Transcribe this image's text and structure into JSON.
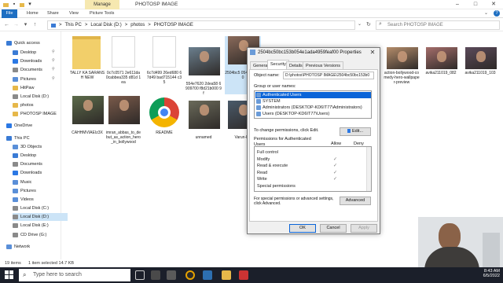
{
  "window": {
    "title": "PHOTOSP IMAGE",
    "manage_tab": "Manage",
    "minimize": "–",
    "maximize": "□",
    "close": "✕"
  },
  "ribbon": {
    "tabs": [
      "File",
      "Home",
      "Share",
      "View",
      "Picture Tools"
    ]
  },
  "address": {
    "crumbs": [
      "This PC",
      "Local Disk (D:)",
      "photos",
      "PHOTOSP IMAGE"
    ],
    "sep": ">",
    "search_placeholder": "Search PHOTOSP IMAGE"
  },
  "nav": {
    "items": [
      {
        "label": "Quick access",
        "color": "#3a7bd5"
      },
      {
        "label": "Desktop",
        "color": "#3a7bd5"
      },
      {
        "label": "Downloads",
        "color": "#2b78e4"
      },
      {
        "label": "Documents",
        "color": "#8a8a8a"
      },
      {
        "label": "Pictures",
        "color": "#5a8fd8"
      },
      {
        "label": "HitPaw",
        "color": "#e6b84a"
      },
      {
        "label": "Local Disk (D:)",
        "color": "#8a8a8a"
      },
      {
        "label": "photos",
        "color": "#e6b84a"
      },
      {
        "label": "PHOTOSP IMAGE",
        "color": "#e6b84a"
      },
      {
        "label": "OneDrive",
        "color": "#2b78e4"
      },
      {
        "label": "This PC",
        "color": "#3a7bd5"
      },
      {
        "label": "3D Objects",
        "color": "#5a8fd8"
      },
      {
        "label": "Desktop",
        "color": "#3a7bd5"
      },
      {
        "label": "Documents",
        "color": "#8a8a8a"
      },
      {
        "label": "Downloads",
        "color": "#2b78e4"
      },
      {
        "label": "Music",
        "color": "#5a8fd8"
      },
      {
        "label": "Pictures",
        "color": "#5a8fd8"
      },
      {
        "label": "Videos",
        "color": "#5a8fd8"
      },
      {
        "label": "Local Disk (C:)",
        "color": "#8a8a8a"
      },
      {
        "label": "Local Disk (D:)",
        "color": "#8a8a8a"
      },
      {
        "label": "Local Disk (E:)",
        "color": "#8a8a8a"
      },
      {
        "label": "CD Drive (G:)",
        "color": "#8a8a8a"
      },
      {
        "label": "Network",
        "color": "#5a8fd8"
      }
    ]
  },
  "files": [
    {
      "name": "TALLY KA SARANSH NEW",
      "kind": "folder"
    },
    {
      "name": "0c7c0571 2e611da 0cabbea335 d81d 1ea",
      "kind": "blank"
    },
    {
      "name": "6c7d499 26ed680 67d49 bad715144 c35",
      "kind": "blank"
    },
    {
      "name": "554e7620 2dea58 6909700 f8d21b000 9f",
      "kind": "photo",
      "color": "#6b7f8e"
    },
    {
      "name": "2504bc5 054e1ad f00",
      "kind": "photo",
      "color": "#8a6a5a"
    },
    {
      "name": "action-bollywood-comedy-hero-wallpaper-preview",
      "kind": "photo",
      "color": "#b48c6a"
    },
    {
      "name": "avika211019_082",
      "kind": "photo",
      "color": "#a46d6a"
    },
    {
      "name": "avika211019_103",
      "kind": "photo",
      "color": "#5b4a5a"
    },
    {
      "name": "CAHHMVIAEIz3X",
      "kind": "photo",
      "color": "#5c6b4a"
    },
    {
      "name": "imran_abbas_to_debut_as_action_hero_in_bollywood",
      "kind": "photo",
      "color": "#7a5a4a"
    },
    {
      "name": "README",
      "kind": "chrome"
    },
    {
      "name": "unnamed",
      "kind": "photo",
      "color": "#6a6a5a"
    },
    {
      "name": "Varun-Dh",
      "kind": "photo",
      "color": "#4a5a6a"
    }
  ],
  "status": {
    "count": "19 items",
    "selection": "1 item selected 14.7 KB"
  },
  "taskbar": {
    "search": "Type here to search",
    "time": "8:43 AM",
    "date": "6/5/2022"
  },
  "dialog": {
    "title": "2504bc50bc153b054e1ada4959feaf00 Properties",
    "close": "✕",
    "tabs": [
      "General",
      "Security",
      "Details",
      "Previous Versions"
    ],
    "object_name_label": "Object name:",
    "object_name_value": "D:\\photos\\PHOTOSP IMAGE\\2504bc50bc153b0",
    "group_label": "Group or user names:",
    "groups": [
      "Authenticated Users",
      "SYSTEM",
      "Administrators (DESKTOP-KD6IT77\\Administrators)",
      "Users (DESKTOP-KD6IT77\\Users)"
    ],
    "change_hint": "To change permissions, click Edit.",
    "edit_button": "Edit...",
    "perm_for": "Permissions for Authenticated Users",
    "allow": "Allow",
    "deny": "Deny",
    "permissions": [
      {
        "name": "Full control",
        "allow": false
      },
      {
        "name": "Modify",
        "allow": true
      },
      {
        "name": "Read & execute",
        "allow": true
      },
      {
        "name": "Read",
        "allow": true
      },
      {
        "name": "Write",
        "allow": true
      },
      {
        "name": "Special permissions",
        "allow": false
      }
    ],
    "advanced_hint": "For special permissions or advanced settings, click Advanced.",
    "advanced_button": "Advanced",
    "ok": "OK",
    "cancel": "Cancel",
    "apply": "Apply"
  }
}
